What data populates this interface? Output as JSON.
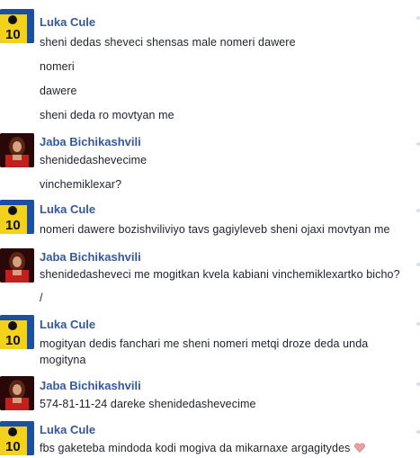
{
  "messages": [
    {
      "sender": "Luka Cule",
      "avatar": "luka-cule-avatar",
      "lines": [
        "sheni dedas sheveci shensas male nomeri dawere",
        "nomeri",
        "dawere",
        "sheni deda ro movtyan me"
      ]
    },
    {
      "sender": "Jaba Bichikashvili",
      "avatar": "jaba-bichikashvili-avatar",
      "lines": [
        "shenidedashevecime",
        "vinchemiklexar?"
      ]
    },
    {
      "sender": "Luka Cule",
      "avatar": "luka-cule-avatar",
      "lines": [
        "nomeri dawere bozishviliviyo tavs gagiyleveb sheni ojaxi movtyan me"
      ]
    },
    {
      "sender": "Jaba Bichikashvili",
      "avatar": "jaba-bichikashvili-avatar",
      "lines": [
        "shenidedasheveci me mogitkan kvela kabiani vinchemiklexartko bicho?",
        "/"
      ]
    },
    {
      "sender": "Luka Cule",
      "avatar": "luka-cule-avatar",
      "lines": [
        "mogityan dedis fanchari me sheni nomeri metqi droze deda unda",
        "mogityna"
      ]
    },
    {
      "sender": "Jaba Bichikashvili",
      "avatar": "jaba-bichikashvili-avatar",
      "lines": [
        "574-81-11-24 dareke shenidedashevecime"
      ]
    },
    {
      "sender": "Luka Cule",
      "avatar": "luka-cule-avatar",
      "lines": [
        "fbs gaketeba mindoda kodi mogiva da mikarnaxe argagitydes"
      ],
      "trailing_icon": "heart-emoji-icon"
    }
  ],
  "avatar_badge": "10",
  "colors": {
    "sender_name": "#365899",
    "message_text": "#1d2129",
    "heart": "#e8a0a0"
  }
}
